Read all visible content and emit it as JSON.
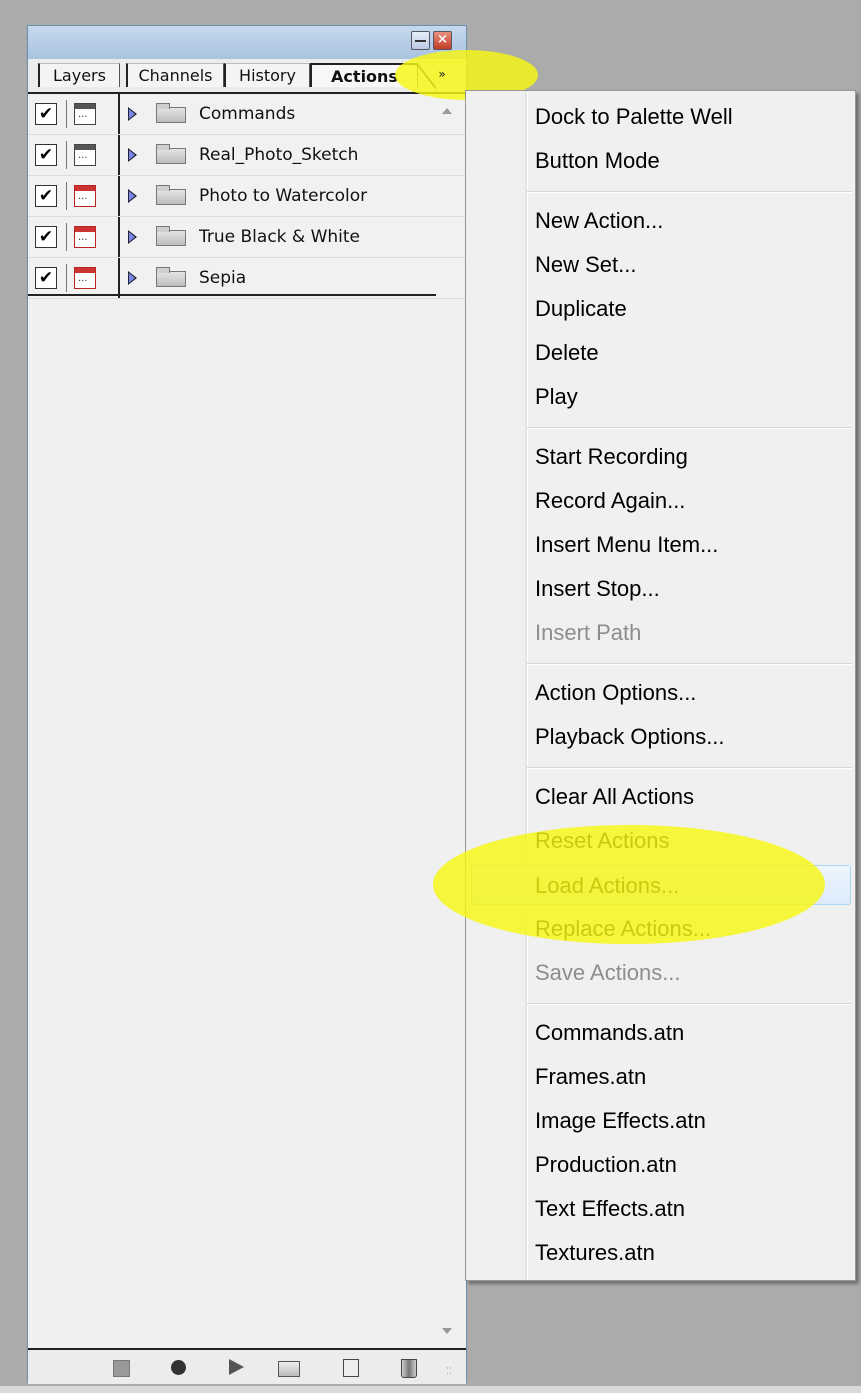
{
  "palette": {
    "tabs": [
      "Layers",
      "Channels",
      "History",
      "Actions"
    ],
    "active_tab": "Actions",
    "flyout_arrow": "»",
    "actions": [
      {
        "label": "Commands",
        "dialog_color": "gray"
      },
      {
        "label": "Real_Photo_Sketch",
        "dialog_color": "gray"
      },
      {
        "label": "Photo to Watercolor",
        "dialog_color": "red"
      },
      {
        "label": "True Black & White",
        "dialog_color": "red"
      },
      {
        "label": "Sepia",
        "dialog_color": "red"
      }
    ],
    "check_glyph": "✔",
    "toolbar_icons": [
      "stop-icon",
      "record-icon",
      "play-icon",
      "new-set-icon",
      "new-action-icon",
      "delete-icon"
    ]
  },
  "menu": {
    "groups": [
      [
        "Dock to Palette Well",
        "Button Mode"
      ],
      [
        "New Action...",
        "New Set...",
        "Duplicate",
        "Delete",
        "Play"
      ],
      [
        "Start Recording",
        "Record Again...",
        "Insert Menu Item...",
        "Insert Stop...",
        "Insert Path"
      ],
      [
        "Action Options...",
        "Playback Options..."
      ],
      [
        "Clear All Actions",
        "Reset Actions",
        "Load Actions...",
        "Replace Actions...",
        "Save Actions..."
      ],
      [
        "Commands.atn",
        "Frames.atn",
        "Image Effects.atn",
        "Production.atn",
        "Text Effects.atn",
        "Textures.atn"
      ]
    ],
    "disabled": [
      "Insert Path",
      "Save Actions..."
    ],
    "highlighted": "Load Actions..."
  },
  "colors": {
    "highlighter": "#f7f712",
    "menu_hover": "#dcebfc",
    "background": "#ababab"
  }
}
